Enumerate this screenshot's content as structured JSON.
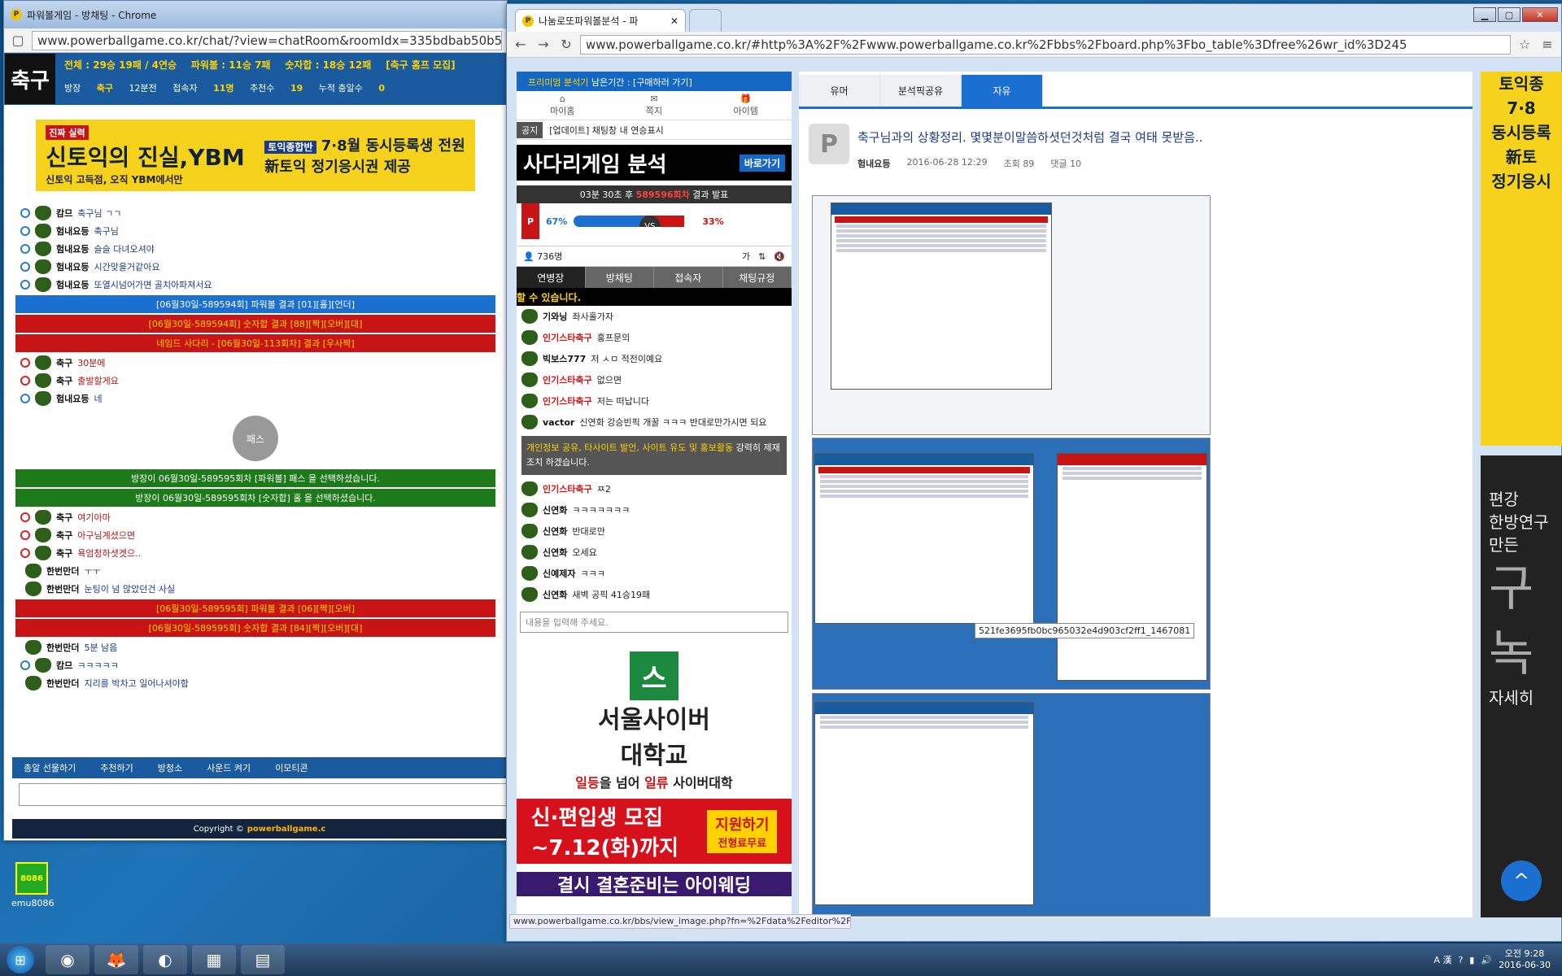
{
  "left_window": {
    "title": "파워볼게임 - 방채팅 - Chrome",
    "url": "www.powerballgame.co.kr/chat/?view=chatRoom&roomIdx=335bdbab50b58e7e",
    "room_logo": "축구",
    "stats": {
      "total": "전체 : 29승 19패 / 4연승",
      "powerball": "파워볼 : 11승 7패",
      "number": "숫자합 : 18승 12패",
      "join": "[축구 홈프 모집]"
    },
    "info": {
      "host_label": "방장",
      "host": "축구",
      "elapsed": "12분전",
      "users_label": "접속자",
      "users": "11명",
      "recommend_label": "추천수",
      "recommend": "19",
      "gift_label": "누적 충알수",
      "gift": "0"
    },
    "banner": {
      "left": "신토익의 진실,YBM",
      "tag": "진짜 실력",
      "sub": "신토익 고득점, 오직 YBM에서만",
      "right": "7·8월 동시등록생 전원",
      "right2": "新토익 정기응시권 제공",
      "right_tag": "토익종합반"
    },
    "chat": [
      {
        "type": "msg",
        "nick": "캄므",
        "text": "축구님 ㄱㄱ",
        "icon": "blue"
      },
      {
        "type": "msg",
        "nick": "험내요등",
        "text": "축구님",
        "icon": "blue"
      },
      {
        "type": "msg",
        "nick": "험내요등",
        "text": "슬슬 다녀오셔야",
        "icon": "blue"
      },
      {
        "type": "msg",
        "nick": "험내요등",
        "text": "시간맞을거같아요",
        "icon": "blue"
      },
      {
        "type": "msg",
        "nick": "험내요등",
        "text": "또열시넘어가면 골치아파져서요",
        "icon": "blue"
      }
    ],
    "notice1": "[06월30일-589594회] 파워볼 결과 [01][홀][언더]",
    "notice2": "[06월30일-589594회] 숫자합 결과 [88][짝][오버][대]",
    "notice3": "네임드 사다리 - [06월30일-113회차] 결과 [우사짝]",
    "chat2": [
      {
        "nick": "축구",
        "text": "30분에",
        "icon": "red"
      },
      {
        "nick": "축구",
        "text": "출발할게요",
        "icon": "red"
      },
      {
        "nick": "험내요등",
        "text": "네",
        "icon": "blue"
      }
    ],
    "pass_label": "패스",
    "notice4": "방장이 06월30일-589595회차 [파워볼] 패스 을 선택하셨습니다.",
    "notice5": "방장이 06월30일-589595회차 [숫자합] 홀 을 선택하셨습니다.",
    "chat3": [
      {
        "nick": "축구",
        "text": "여기아마",
        "icon": "red"
      },
      {
        "nick": "축구",
        "text": "아구님계셨으면",
        "icon": "red"
      },
      {
        "nick": "축구",
        "text": "욕엄청하셧겟으..",
        "icon": "red"
      },
      {
        "nick": "한번만더",
        "text": "ㅜㅜ",
        "icon": "none"
      },
      {
        "nick": "한번만더",
        "text": "눈팅이 넘 많았던건 사실",
        "icon": "none"
      }
    ],
    "notice6": "[06월30일-589595회] 파워볼 결과 [06][짝][오버]",
    "notice7": "[06월30일-589595회] 숫자합 결과 [84][짝][오버][대]",
    "chat4": [
      {
        "nick": "한번만더",
        "text": "5분 남음",
        "icon": "none"
      },
      {
        "nick": "캄므",
        "text": "ㅋㅋㅋㅋㅋ",
        "icon": "blue"
      },
      {
        "nick": "한번만더",
        "text": "지리를 박차고 일어나셔야함",
        "icon": "none"
      }
    ],
    "bottom": [
      "총알 선물하기",
      "추천하기",
      "방청소",
      "사운드 켜기",
      "이모티콘"
    ],
    "copyright": "Copyright ©",
    "copyright_brand": "powerballgame.c"
  },
  "right_window": {
    "tab_title": "나눔로또파워볼분석 - 파",
    "url": "www.powerballgame.co.kr/#http%3A%2F%2Fwww.powerballgame.co.kr%2Fbbs%2Fboard.php%3Fbo_table%3Dfree%26wr_id%3D245",
    "premium": "프리미엄 분석기",
    "premium_rest": "남은기간 : [구매하러 가기]",
    "icons": [
      "마이홈",
      "쪽지",
      "아이템"
    ],
    "notice_tag": "공지",
    "notice_text": "[업데이트] 채팅창 내 연승표시",
    "ladder": "사다리게임 분석",
    "ladder_go": "바로가기",
    "round_text": "03분 30초 후",
    "round_num": "589596회차",
    "round_tail": "결과 발표",
    "vs": {
      "left": "67%",
      "right": "33%",
      "p": "P",
      "c": "VS",
      "left_value": 67
    },
    "users": "736명",
    "tabs": [
      "연병장",
      "방채팅",
      "접속자",
      "채팅규정"
    ],
    "warn": "할 수 있습니다.",
    "chat": [
      {
        "nick": "기와닝",
        "text": "좌사홀가자",
        "star": false
      },
      {
        "nick": "인기스타축구",
        "text": "홍프문의",
        "star": true
      },
      {
        "nick": "빅보스777",
        "text": "저 ㅅㅁ 적전이예요",
        "star": false
      },
      {
        "nick": "인기스타축구",
        "text": "없으면",
        "star": true
      },
      {
        "nick": "인기스타축구",
        "text": "저는 떠납니다",
        "star": true
      },
      {
        "nick": "vactor",
        "text": "신연화 강승빈픽 개꿀 ㅋㅋㅋ 반대로만가시면 되요",
        "star": false
      }
    ],
    "grey_notice_hl": "개인정보 공유, 타사이트 발언, 사이트 유도 및 홍보활동",
    "grey_notice_rest": "강력히 제재조치 하겠습니다.",
    "chat2": [
      {
        "nick": "인기스타축구",
        "text": "ㅉ2",
        "star": true
      },
      {
        "nick": "신연화",
        "text": "ㅋㅋㅋㅋㅋㅋㅋ",
        "star": false
      },
      {
        "nick": "신연화",
        "text": "반대로만",
        "star": false
      },
      {
        "nick": "신연화",
        "text": "오세요",
        "star": false
      },
      {
        "nick": "신예제자",
        "text": "ㅋㅋㅋ",
        "star": false
      },
      {
        "nick": "신연화",
        "text": "새벽 공픽 41승19패",
        "star": false
      }
    ],
    "input_placeholder": "내용을 입력해 주세요.",
    "ad_cyber_logo": "스",
    "ad_cyber": "서울사이버",
    "ad_cyber2": "대학교",
    "ad_cyber_sub1": "일등",
    "ad_cyber_sub2": "을 넘어",
    "ad_cyber_sub3": "일류",
    "ad_cyber_sub4": "사이버대학",
    "ad_red": "신·편입생 모집",
    "ad_red2": "~7.12(화)까지",
    "ad_red_btn": "지원하기",
    "ad_red_btn2": "전형료무료",
    "ad_purple": "결시 결혼준비는 아이웨딩",
    "board_tabs": [
      "유머",
      "분석픽공유",
      "자유"
    ],
    "post_title": "축구님과의 상황정리. 몇몇분이말씀하셧던것처럼 결국 여태 못받음..",
    "post_author": "험내요등",
    "post_date": "2016-06-28 12:29",
    "post_views": "조회 89",
    "post_comments": "댓글 10",
    "tooltip": "521fe3695fb0bc965032e4d903cf2ff1_1467081",
    "statusbar": "www.powerballgame.co.kr/bbs/view_image.php?fn=%2Fdata%2Feditor%2F1...",
    "right_ad": [
      "토익종",
      "7·8",
      "동시등록",
      "新토",
      "정기응시"
    ],
    "right_ad2": [
      "편강",
      "한방연구",
      "만든"
    ],
    "right_ad2_big": [
      "구",
      "녹"
    ],
    "right_ad2_foot": "자세히",
    "scroll_up": "^"
  },
  "taskbar": {
    "start": "⊞",
    "apps": [
      "◉",
      "🦊",
      "◐",
      "▦",
      "▤"
    ],
    "tray_lang": "A 漢",
    "time": "오전 9:28",
    "date": "2016-06-30"
  },
  "desktop_icon": {
    "label": "emu8086",
    "text": "8086"
  }
}
